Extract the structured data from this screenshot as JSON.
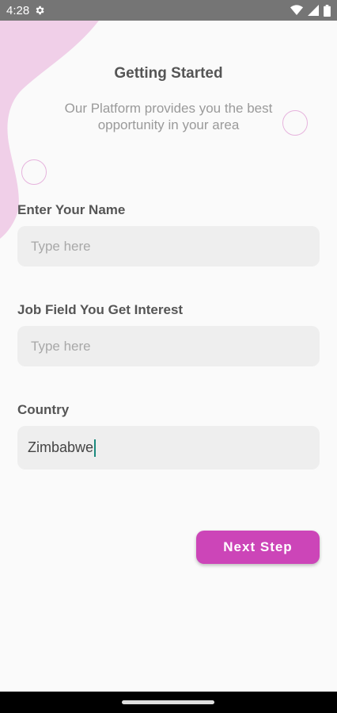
{
  "status_bar": {
    "time": "4:28",
    "icons": [
      "gear-icon",
      "wifi-icon",
      "signal-icon",
      "battery-icon"
    ]
  },
  "header": {
    "title": "Getting Started",
    "subtitle": "Our Platform provides you the best opportunity in your area"
  },
  "form": {
    "name": {
      "label": "Enter Your Name",
      "placeholder": "Type here",
      "value": ""
    },
    "job_field": {
      "label": "Job Field You Get Interest",
      "placeholder": "Type here",
      "value": ""
    },
    "country": {
      "label": "Country",
      "value": "Zimbabwe"
    }
  },
  "actions": {
    "next_label": "Next Step"
  },
  "colors": {
    "accent": "#cc45b8",
    "blob": "#f0cfe8",
    "status_bar": "#757575",
    "input_bg": "#eeeeee",
    "caret": "#1a8a7e"
  }
}
